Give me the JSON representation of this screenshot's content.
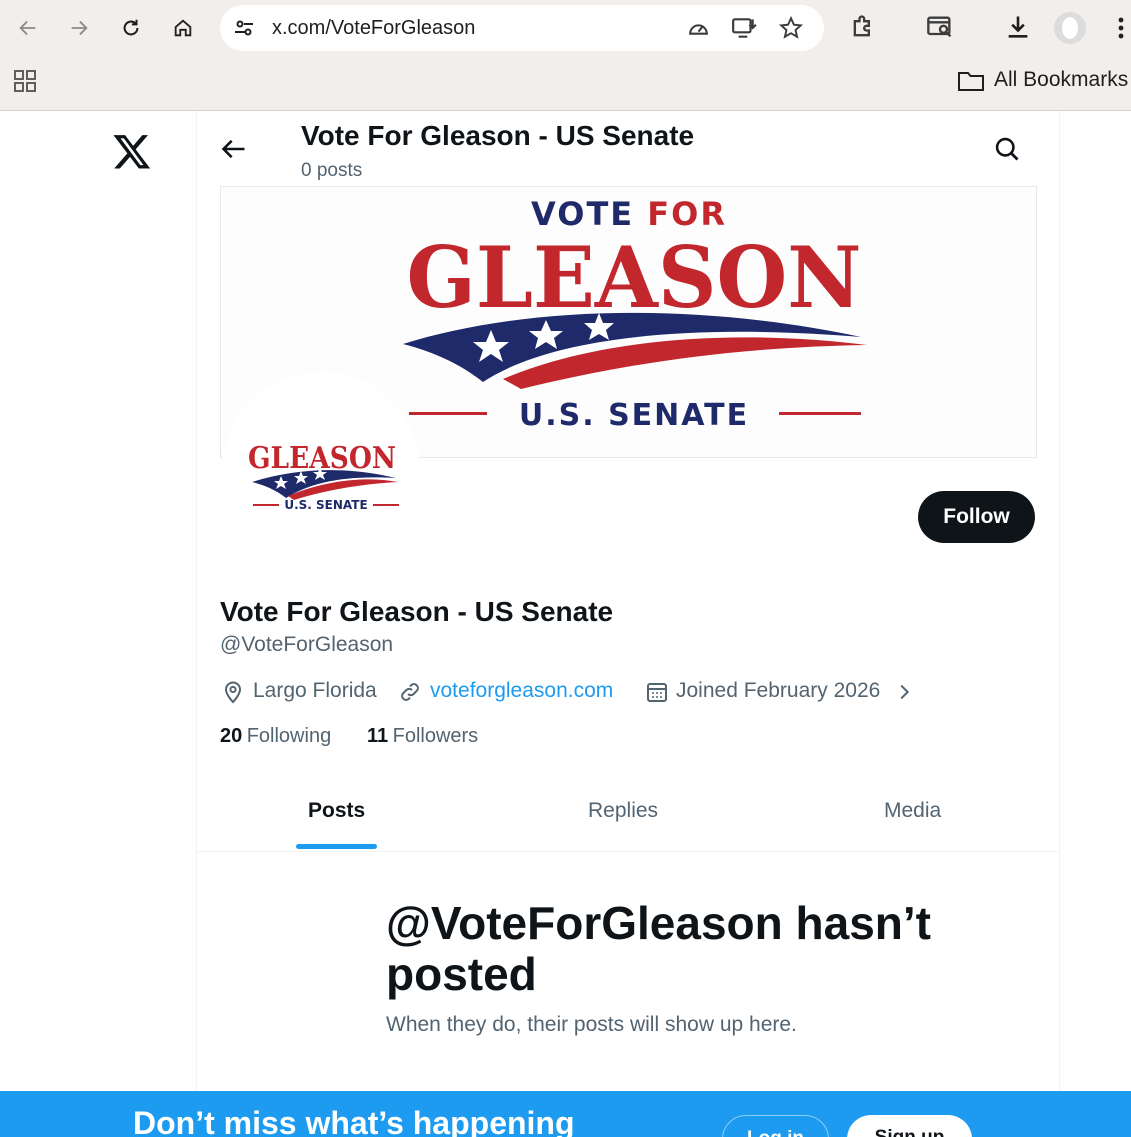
{
  "browser": {
    "url": "x.com/VoteForGleason",
    "bookmarks_label": "All Bookmarks",
    "icons": [
      "back-arrow-icon",
      "forward-arrow-icon",
      "reload-icon",
      "home-icon",
      "site-settings-icon",
      "performance-icon",
      "install-app-icon",
      "bookmark-star-icon",
      "extensions-icon",
      "search-tabs-icon",
      "download-icon",
      "profile-avatar-icon",
      "menu-kebab-icon",
      "apps-grid-icon",
      "folder-icon"
    ]
  },
  "topbar": {
    "title": "Vote For Gleason - US Senate",
    "post_count": "0 posts"
  },
  "banner": {
    "line1_a": "VOTE",
    "line1_b": "FOR",
    "line2": "GLEASON",
    "line3": "U.S. SENATE"
  },
  "avatar": {
    "line1": "GLEASON",
    "line2": "U.S. SENATE"
  },
  "profile": {
    "name": "Vote For Gleason - US Senate",
    "handle": "@VoteForGleason",
    "location": "Largo Florida",
    "website": "voteforgleason.com",
    "joined": "Joined February 2026",
    "following_count": "20",
    "following_label": "Following",
    "followers_count": "11",
    "followers_label": "Followers",
    "follow_label": "Follow"
  },
  "tabs": [
    {
      "label": "Posts",
      "selected": true
    },
    {
      "label": "Replies",
      "selected": false
    },
    {
      "label": "Media",
      "selected": false
    }
  ],
  "empty_state": {
    "title": "@VoteForGleason hasn’t posted",
    "subtitle": "When they do, their posts will show up here."
  },
  "bottom_bar": {
    "headline": "Don’t miss what’s happening",
    "login_label": "Log in",
    "signup_label": "Sign up"
  },
  "colors": {
    "accent": "#1d9bf0",
    "logo_red": "#c1272d",
    "logo_navy": "#1f2a6b",
    "text_primary": "#0f1419",
    "text_secondary": "#536471"
  }
}
